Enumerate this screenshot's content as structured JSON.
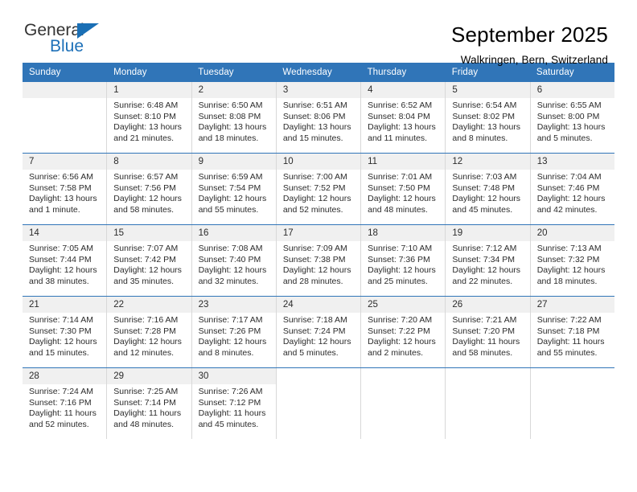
{
  "brand": {
    "name_top": "General",
    "name_bottom": "Blue",
    "flag_icon": "triangle-flag-icon",
    "color_blue": "#1a6fb5",
    "color_dark": "#333333"
  },
  "header": {
    "title": "September 2025",
    "subtitle": "Walkringen, Bern, Switzerland"
  },
  "theme": {
    "header_bg": "#3075b8",
    "header_text": "#ffffff",
    "day_band_bg": "#f0f0f0",
    "cell_border": "#d8d8d8",
    "row_divider": "#3075b8"
  },
  "weekdays": [
    "Sunday",
    "Monday",
    "Tuesday",
    "Wednesday",
    "Thursday",
    "Friday",
    "Saturday"
  ],
  "weeks": [
    [
      {
        "day": "",
        "sunrise": "",
        "sunset": "",
        "daylight1": "",
        "daylight2": "",
        "empty": true
      },
      {
        "day": "1",
        "sunrise": "Sunrise: 6:48 AM",
        "sunset": "Sunset: 8:10 PM",
        "daylight1": "Daylight: 13 hours",
        "daylight2": "and 21 minutes."
      },
      {
        "day": "2",
        "sunrise": "Sunrise: 6:50 AM",
        "sunset": "Sunset: 8:08 PM",
        "daylight1": "Daylight: 13 hours",
        "daylight2": "and 18 minutes."
      },
      {
        "day": "3",
        "sunrise": "Sunrise: 6:51 AM",
        "sunset": "Sunset: 8:06 PM",
        "daylight1": "Daylight: 13 hours",
        "daylight2": "and 15 minutes."
      },
      {
        "day": "4",
        "sunrise": "Sunrise: 6:52 AM",
        "sunset": "Sunset: 8:04 PM",
        "daylight1": "Daylight: 13 hours",
        "daylight2": "and 11 minutes."
      },
      {
        "day": "5",
        "sunrise": "Sunrise: 6:54 AM",
        "sunset": "Sunset: 8:02 PM",
        "daylight1": "Daylight: 13 hours",
        "daylight2": "and 8 minutes."
      },
      {
        "day": "6",
        "sunrise": "Sunrise: 6:55 AM",
        "sunset": "Sunset: 8:00 PM",
        "daylight1": "Daylight: 13 hours",
        "daylight2": "and 5 minutes."
      }
    ],
    [
      {
        "day": "7",
        "sunrise": "Sunrise: 6:56 AM",
        "sunset": "Sunset: 7:58 PM",
        "daylight1": "Daylight: 13 hours",
        "daylight2": "and 1 minute."
      },
      {
        "day": "8",
        "sunrise": "Sunrise: 6:57 AM",
        "sunset": "Sunset: 7:56 PM",
        "daylight1": "Daylight: 12 hours",
        "daylight2": "and 58 minutes."
      },
      {
        "day": "9",
        "sunrise": "Sunrise: 6:59 AM",
        "sunset": "Sunset: 7:54 PM",
        "daylight1": "Daylight: 12 hours",
        "daylight2": "and 55 minutes."
      },
      {
        "day": "10",
        "sunrise": "Sunrise: 7:00 AM",
        "sunset": "Sunset: 7:52 PM",
        "daylight1": "Daylight: 12 hours",
        "daylight2": "and 52 minutes."
      },
      {
        "day": "11",
        "sunrise": "Sunrise: 7:01 AM",
        "sunset": "Sunset: 7:50 PM",
        "daylight1": "Daylight: 12 hours",
        "daylight2": "and 48 minutes."
      },
      {
        "day": "12",
        "sunrise": "Sunrise: 7:03 AM",
        "sunset": "Sunset: 7:48 PM",
        "daylight1": "Daylight: 12 hours",
        "daylight2": "and 45 minutes."
      },
      {
        "day": "13",
        "sunrise": "Sunrise: 7:04 AM",
        "sunset": "Sunset: 7:46 PM",
        "daylight1": "Daylight: 12 hours",
        "daylight2": "and 42 minutes."
      }
    ],
    [
      {
        "day": "14",
        "sunrise": "Sunrise: 7:05 AM",
        "sunset": "Sunset: 7:44 PM",
        "daylight1": "Daylight: 12 hours",
        "daylight2": "and 38 minutes."
      },
      {
        "day": "15",
        "sunrise": "Sunrise: 7:07 AM",
        "sunset": "Sunset: 7:42 PM",
        "daylight1": "Daylight: 12 hours",
        "daylight2": "and 35 minutes."
      },
      {
        "day": "16",
        "sunrise": "Sunrise: 7:08 AM",
        "sunset": "Sunset: 7:40 PM",
        "daylight1": "Daylight: 12 hours",
        "daylight2": "and 32 minutes."
      },
      {
        "day": "17",
        "sunrise": "Sunrise: 7:09 AM",
        "sunset": "Sunset: 7:38 PM",
        "daylight1": "Daylight: 12 hours",
        "daylight2": "and 28 minutes."
      },
      {
        "day": "18",
        "sunrise": "Sunrise: 7:10 AM",
        "sunset": "Sunset: 7:36 PM",
        "daylight1": "Daylight: 12 hours",
        "daylight2": "and 25 minutes."
      },
      {
        "day": "19",
        "sunrise": "Sunrise: 7:12 AM",
        "sunset": "Sunset: 7:34 PM",
        "daylight1": "Daylight: 12 hours",
        "daylight2": "and 22 minutes."
      },
      {
        "day": "20",
        "sunrise": "Sunrise: 7:13 AM",
        "sunset": "Sunset: 7:32 PM",
        "daylight1": "Daylight: 12 hours",
        "daylight2": "and 18 minutes."
      }
    ],
    [
      {
        "day": "21",
        "sunrise": "Sunrise: 7:14 AM",
        "sunset": "Sunset: 7:30 PM",
        "daylight1": "Daylight: 12 hours",
        "daylight2": "and 15 minutes."
      },
      {
        "day": "22",
        "sunrise": "Sunrise: 7:16 AM",
        "sunset": "Sunset: 7:28 PM",
        "daylight1": "Daylight: 12 hours",
        "daylight2": "and 12 minutes."
      },
      {
        "day": "23",
        "sunrise": "Sunrise: 7:17 AM",
        "sunset": "Sunset: 7:26 PM",
        "daylight1": "Daylight: 12 hours",
        "daylight2": "and 8 minutes."
      },
      {
        "day": "24",
        "sunrise": "Sunrise: 7:18 AM",
        "sunset": "Sunset: 7:24 PM",
        "daylight1": "Daylight: 12 hours",
        "daylight2": "and 5 minutes."
      },
      {
        "day": "25",
        "sunrise": "Sunrise: 7:20 AM",
        "sunset": "Sunset: 7:22 PM",
        "daylight1": "Daylight: 12 hours",
        "daylight2": "and 2 minutes."
      },
      {
        "day": "26",
        "sunrise": "Sunrise: 7:21 AM",
        "sunset": "Sunset: 7:20 PM",
        "daylight1": "Daylight: 11 hours",
        "daylight2": "and 58 minutes."
      },
      {
        "day": "27",
        "sunrise": "Sunrise: 7:22 AM",
        "sunset": "Sunset: 7:18 PM",
        "daylight1": "Daylight: 11 hours",
        "daylight2": "and 55 minutes."
      }
    ],
    [
      {
        "day": "28",
        "sunrise": "Sunrise: 7:24 AM",
        "sunset": "Sunset: 7:16 PM",
        "daylight1": "Daylight: 11 hours",
        "daylight2": "and 52 minutes."
      },
      {
        "day": "29",
        "sunrise": "Sunrise: 7:25 AM",
        "sunset": "Sunset: 7:14 PM",
        "daylight1": "Daylight: 11 hours",
        "daylight2": "and 48 minutes."
      },
      {
        "day": "30",
        "sunrise": "Sunrise: 7:26 AM",
        "sunset": "Sunset: 7:12 PM",
        "daylight1": "Daylight: 11 hours",
        "daylight2": "and 45 minutes."
      },
      {
        "day": "",
        "sunrise": "",
        "sunset": "",
        "daylight1": "",
        "daylight2": "",
        "blank": true
      },
      {
        "day": "",
        "sunrise": "",
        "sunset": "",
        "daylight1": "",
        "daylight2": "",
        "blank": true
      },
      {
        "day": "",
        "sunrise": "",
        "sunset": "",
        "daylight1": "",
        "daylight2": "",
        "blank": true
      },
      {
        "day": "",
        "sunrise": "",
        "sunset": "",
        "daylight1": "",
        "daylight2": "",
        "blank": true
      }
    ]
  ]
}
